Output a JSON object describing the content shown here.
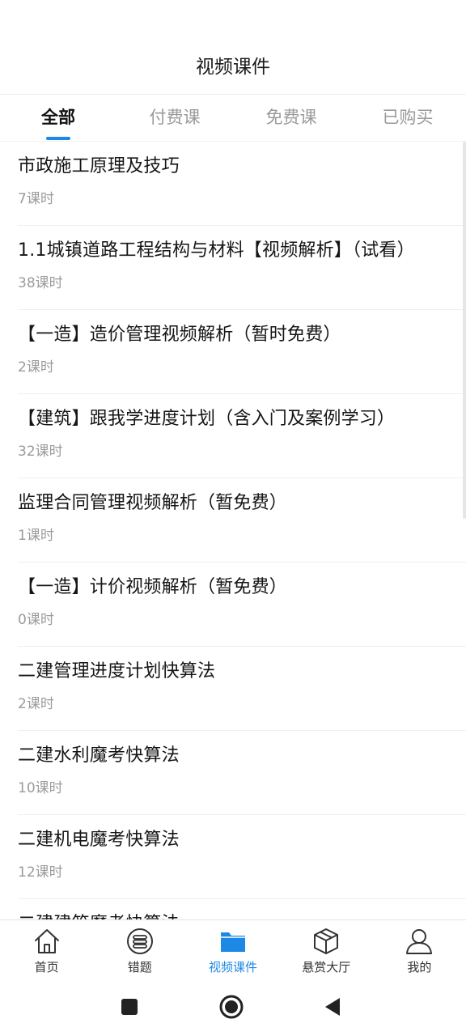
{
  "header": {
    "title": "视频课件"
  },
  "tabs": [
    {
      "label": "全部",
      "active": true
    },
    {
      "label": "付费课",
      "active": false
    },
    {
      "label": "免费课",
      "active": false
    },
    {
      "label": "已购买",
      "active": false
    }
  ],
  "courses": [
    {
      "title": "市政施工原理及技巧",
      "lessons": "7课时"
    },
    {
      "title": "1.1城镇道路工程结构与材料【视频解析】（试看）",
      "lessons": "38课时"
    },
    {
      "title": "【一造】造价管理视频解析（暂时免费）",
      "lessons": "2课时"
    },
    {
      "title": "【建筑】跟我学进度计划（含入门及案例学习）",
      "lessons": "32课时"
    },
    {
      "title": "监理合同管理视频解析（暂免费）",
      "lessons": "1课时"
    },
    {
      "title": "【一造】计价视频解析（暂免费）",
      "lessons": "0课时"
    },
    {
      "title": "二建管理进度计划快算法",
      "lessons": "2课时"
    },
    {
      "title": "二建水利魔考快算法",
      "lessons": "10课时"
    },
    {
      "title": "二建机电魔考快算法",
      "lessons": "12课时"
    },
    {
      "title": "二建建筑魔考快算法",
      "lessons": ""
    }
  ],
  "tabbar": [
    {
      "label": "首页",
      "icon": "home-icon",
      "active": false
    },
    {
      "label": "错题",
      "icon": "list-icon",
      "active": false
    },
    {
      "label": "视频课件",
      "icon": "folder-icon",
      "active": true
    },
    {
      "label": "悬赏大厅",
      "icon": "box-icon",
      "active": false
    },
    {
      "label": "我的",
      "icon": "user-icon",
      "active": false
    }
  ],
  "colors": {
    "accent": "#1e88e5",
    "text": "#151515",
    "muted": "#9b9b9b"
  }
}
